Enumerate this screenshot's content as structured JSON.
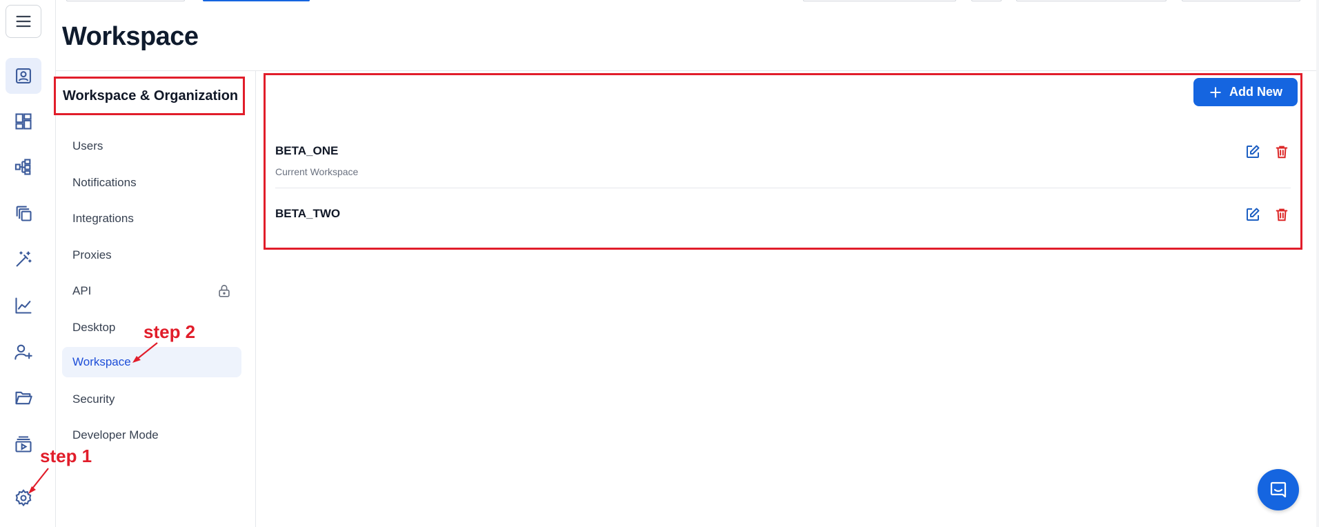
{
  "page": {
    "title": "Workspace"
  },
  "subnav": {
    "header": "Workspace & Organization",
    "items": [
      {
        "label": "Users"
      },
      {
        "label": "Notifications"
      },
      {
        "label": "Integrations"
      },
      {
        "label": "Proxies"
      },
      {
        "label": "API",
        "locked": true
      },
      {
        "label": "Desktop"
      },
      {
        "label": "Workspace",
        "active": true
      },
      {
        "label": "Security"
      },
      {
        "label": "Developer Mode"
      }
    ]
  },
  "content": {
    "add_button_label": "Add New",
    "workspaces": [
      {
        "name": "BETA_ONE",
        "subtitle": "Current Workspace"
      },
      {
        "name": "BETA_TWO"
      }
    ]
  },
  "annotations": {
    "step1": "step 1",
    "step2": "step 2"
  },
  "colors": {
    "accent": "#1565e0",
    "annotation": "#e11d2a",
    "icon": "#3b5a9a",
    "delete": "#dc2626"
  },
  "icons": {
    "rail": [
      "menu-icon",
      "profile-icon",
      "dashboard-icon",
      "workflow-icon",
      "copy-icon",
      "magic-wand-icon",
      "chart-icon",
      "add-user-icon",
      "folder-icon",
      "media-icon",
      "settings-icon"
    ]
  }
}
